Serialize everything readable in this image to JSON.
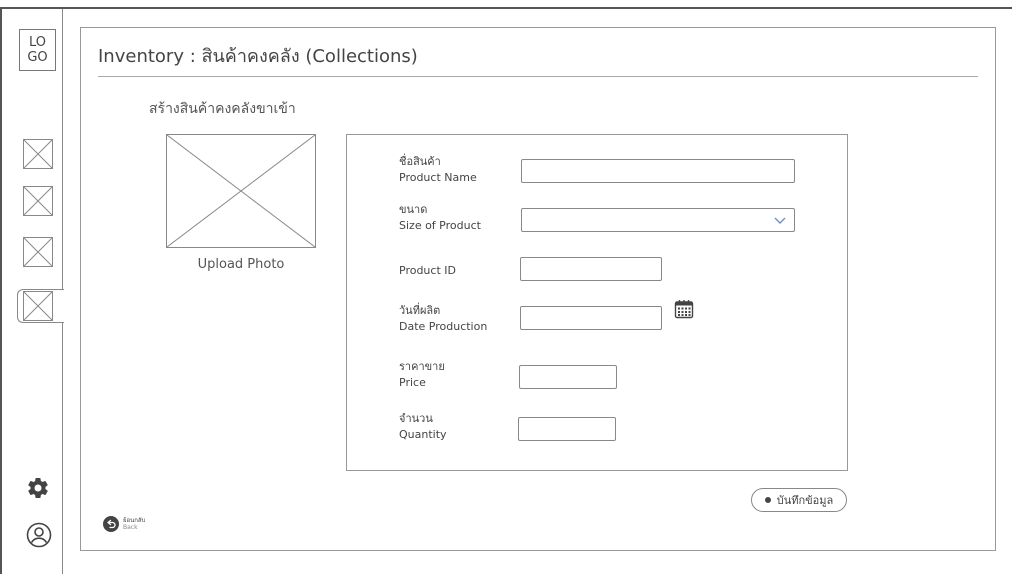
{
  "sidebar": {
    "logo": "LO GO",
    "logo_line1": "LO",
    "logo_line2": "GO",
    "items": [
      {
        "icon": "image-placeholder-icon"
      },
      {
        "icon": "image-placeholder-icon"
      },
      {
        "icon": "image-placeholder-icon"
      },
      {
        "icon": "image-placeholder-icon",
        "active": true
      }
    ],
    "settings_icon": "gear-icon",
    "profile_icon": "user-icon"
  },
  "header": {
    "title": "Inventory : สินค้าคงคลัง (Collections)"
  },
  "main": {
    "section_title": "สร้างสินค้าคงคลังขาเข้า",
    "upload_label": "Upload Photo",
    "form": {
      "product_name": {
        "th": "ชื่อสินค้า",
        "en": "Product Name",
        "value": ""
      },
      "size": {
        "th": "ขนาด",
        "en": "Size of Product",
        "value": ""
      },
      "product_id": {
        "en": "Product ID",
        "value": ""
      },
      "date": {
        "th": "วันที่ผลิต",
        "en": "Date Production",
        "value": ""
      },
      "price": {
        "th": "ราคาขาย",
        "en": "Price",
        "value": ""
      },
      "quantity": {
        "th": "จำนวน",
        "en": "Quantity",
        "value": ""
      }
    },
    "save_label": "บันทึกข้อมูล",
    "back": {
      "th": "ย้อนกลับ",
      "en": "Back"
    }
  },
  "colors": {
    "border": "#888888",
    "text": "#444444",
    "background": "#ffffff"
  }
}
